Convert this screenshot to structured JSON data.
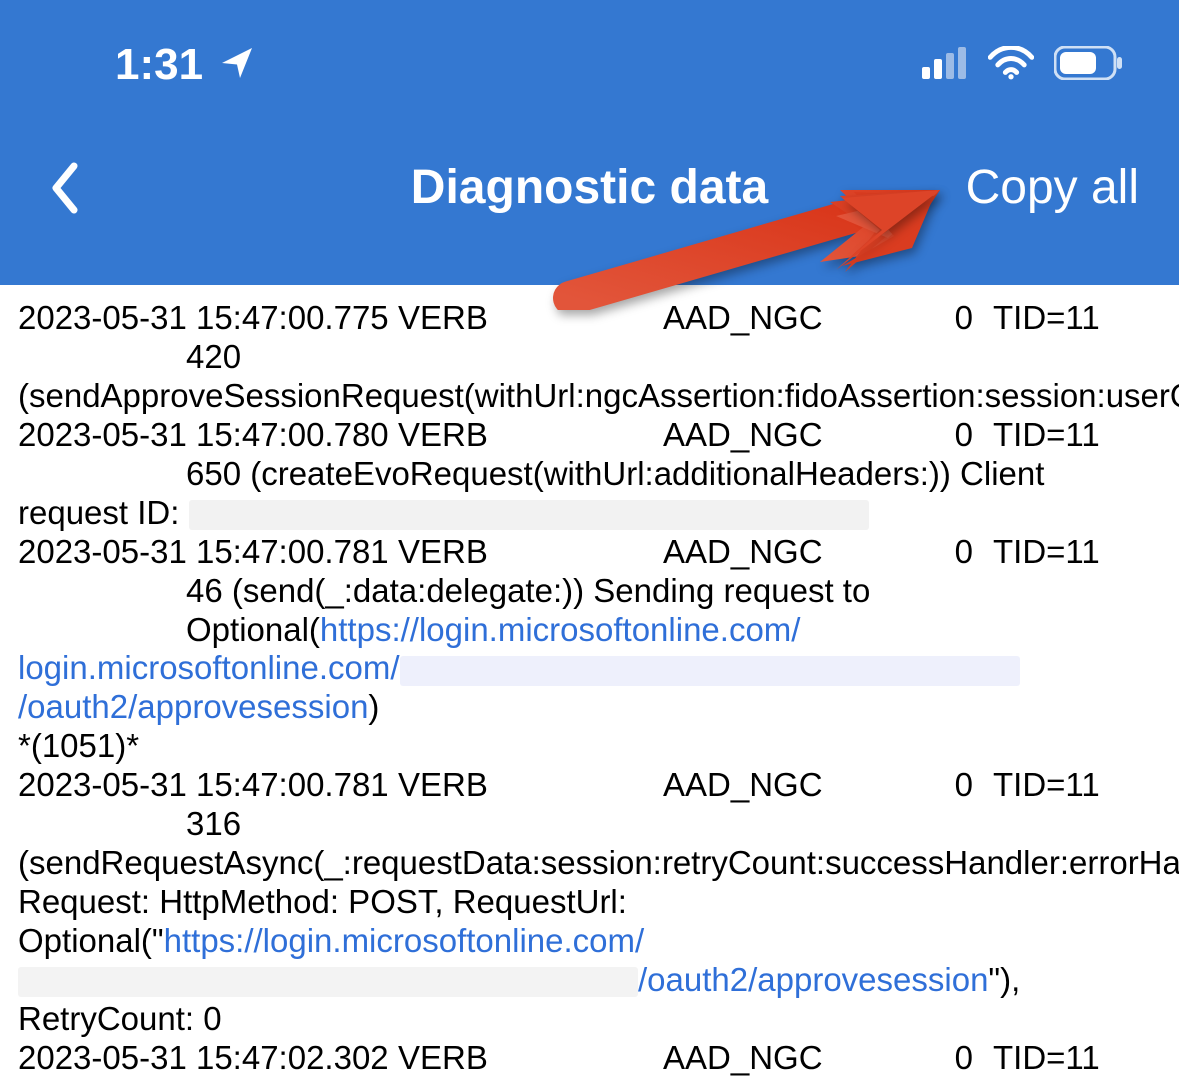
{
  "status": {
    "time": "1:31"
  },
  "nav": {
    "title": "Diagnostic data",
    "copy_all": "Copy all"
  },
  "logs": [
    {
      "ts": "2023-05-31 15:47:00.775",
      "level": "VERB",
      "tag": "AAD_NGC",
      "zero": "0",
      "tid": "TID=11",
      "line1": "420",
      "body": "(sendApproveSessionRequest(withUrl:ngcAssertion:fidoAssertion:session:userObjectId:entropy:))"
    },
    {
      "ts": "2023-05-31 15:47:00.780",
      "level": "VERB",
      "tag": "AAD_NGC",
      "zero": "0",
      "tid": "TID=11",
      "line1_prefix": "650 (createEvoRequest(withUrl:additionalHeaders:)) Client",
      "body_prefix": "request ID: "
    },
    {
      "ts": "2023-05-31 15:47:00.781",
      "level": "VERB",
      "tag": "AAD_NGC",
      "zero": "0",
      "tid": "TID=11",
      "line1_prefix": "46 (send(_:data:delegate:)) Sending request to Optional(",
      "url_a": "https://login.microsoftonline.com/",
      "url_b": "/oauth2/approvesession",
      "body_suffix": ")",
      "body_suffix2": "*(1051)*"
    },
    {
      "ts": "2023-05-31 15:47:00.781",
      "level": "VERB",
      "tag": "AAD_NGC",
      "zero": "0",
      "tid": "TID=11",
      "line1": "316",
      "body_prefix": "(sendRequestAsync(_:requestData:session:retryCount:successHandler:errorHandler:)) Request: HttpMethod: POST, RequestUrl: Optional(\"",
      "url_a": "https://login.microsoftonline.com/",
      "url_b": "/oauth2/approvesession",
      "body_suffix": "\"), RetryCount: 0"
    },
    {
      "ts": "2023-05-31 15:47:02.302",
      "level": "VERB",
      "tag": "AAD_NGC",
      "zero": "0",
      "tid": "TID=11"
    }
  ]
}
